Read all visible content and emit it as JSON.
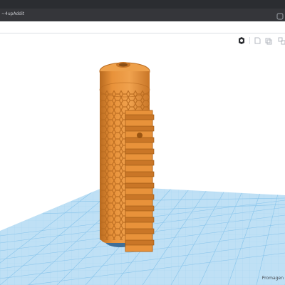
{
  "browser": {
    "tab_text": "~4upAddit"
  },
  "toolbar": {
    "buttons": [
      {
        "name": "mirror-button",
        "icon": "mirror-icon"
      },
      {
        "name": "align-button",
        "icon": "align-icon"
      },
      {
        "name": "group-button",
        "icon": "group-icon"
      },
      {
        "name": "ungroup-button",
        "icon": "ungroup-icon"
      }
    ]
  },
  "viewport": {
    "brand_label": "Promagen"
  },
  "colors": {
    "object_orange": "#e8923a",
    "object_shadow": "#b86a1f",
    "grid_blue": "#b9dcf2",
    "grid_line": "#7fbfe6",
    "base_cap": "#3f6f98"
  }
}
